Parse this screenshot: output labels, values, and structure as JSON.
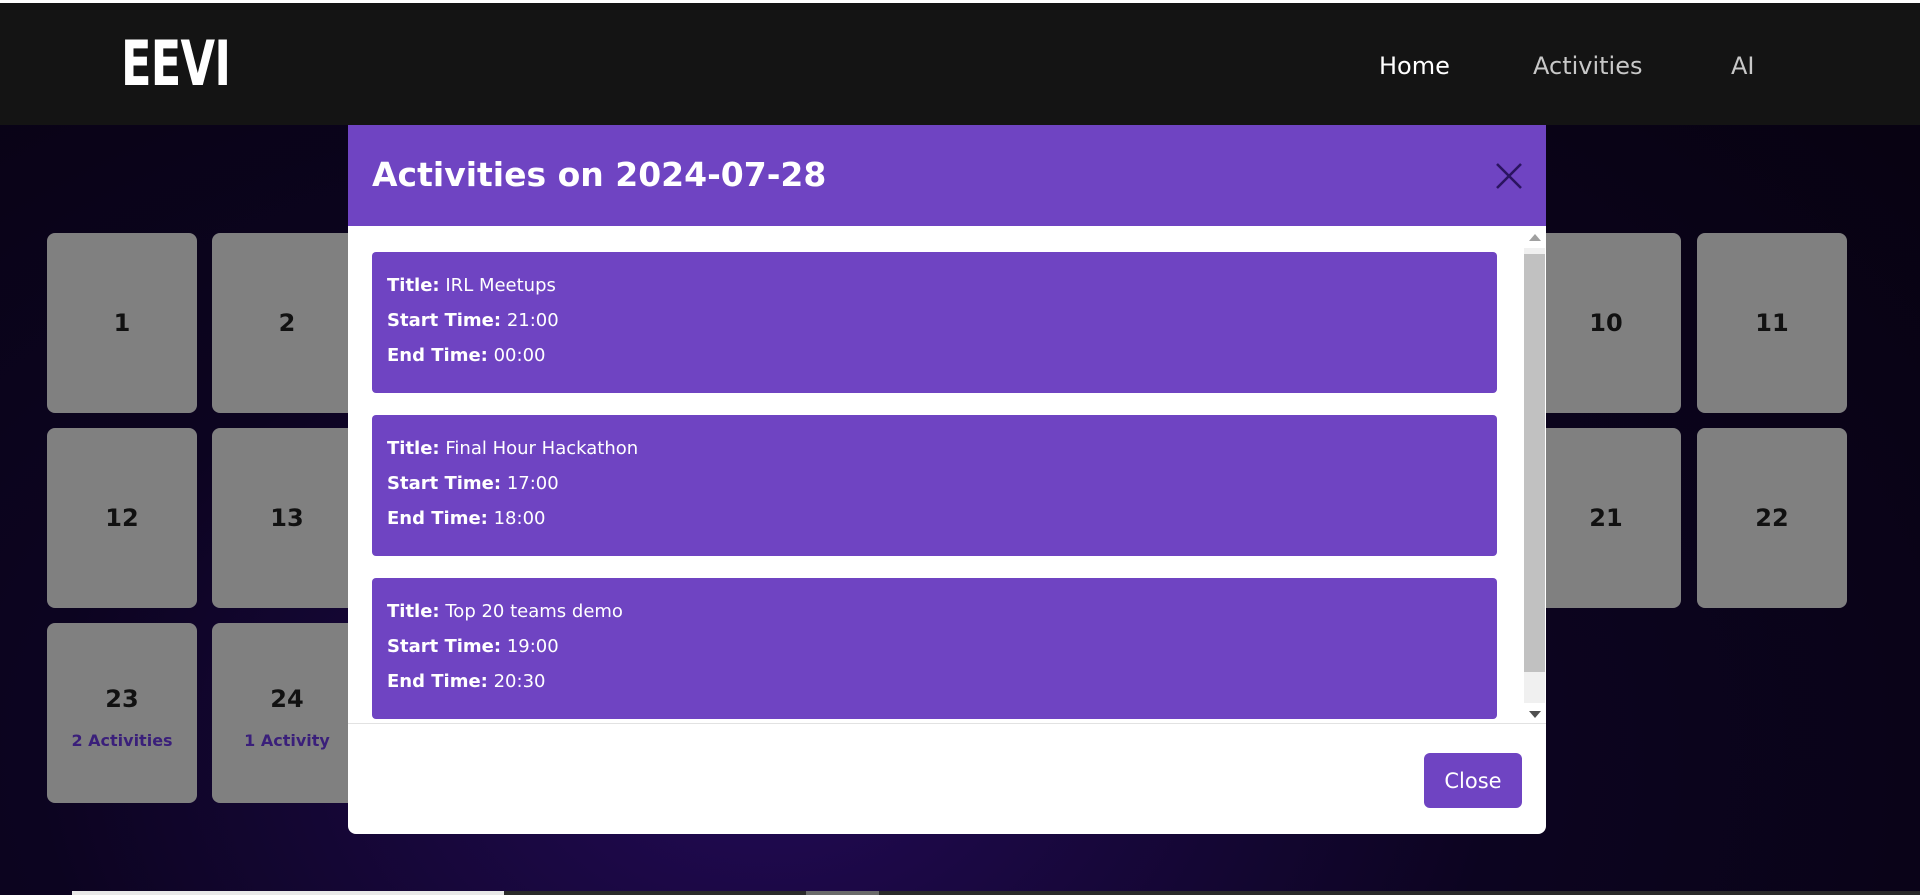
{
  "navbar": {
    "logo": "EEVI",
    "links": [
      {
        "label": "Home"
      },
      {
        "label": "Activities"
      },
      {
        "label": "AI"
      }
    ]
  },
  "calendar": {
    "days": [
      {
        "num": "1"
      },
      {
        "num": "2"
      },
      {
        "num": "10"
      },
      {
        "num": "11"
      },
      {
        "num": "12"
      },
      {
        "num": "13"
      },
      {
        "num": "21"
      },
      {
        "num": "22"
      },
      {
        "num": "23",
        "count": "2 Activities"
      },
      {
        "num": "24",
        "count": "1 Activity"
      }
    ]
  },
  "modal": {
    "title": "Activities on 2024-07-28",
    "labels": {
      "title": "Title:",
      "start": "Start Time:",
      "end": "End Time:"
    },
    "activities": [
      {
        "title": "IRL Meetups",
        "start": "21:00",
        "end": "00:00"
      },
      {
        "title": "Final Hour Hackathon",
        "start": "17:00",
        "end": "18:00"
      },
      {
        "title": "Top 20 teams demo",
        "start": "19:00",
        "end": "20:30"
      }
    ],
    "close_label": "Close"
  },
  "colors": {
    "accent": "#6f44c2",
    "navbar": "#141414",
    "tile": "#808080"
  }
}
